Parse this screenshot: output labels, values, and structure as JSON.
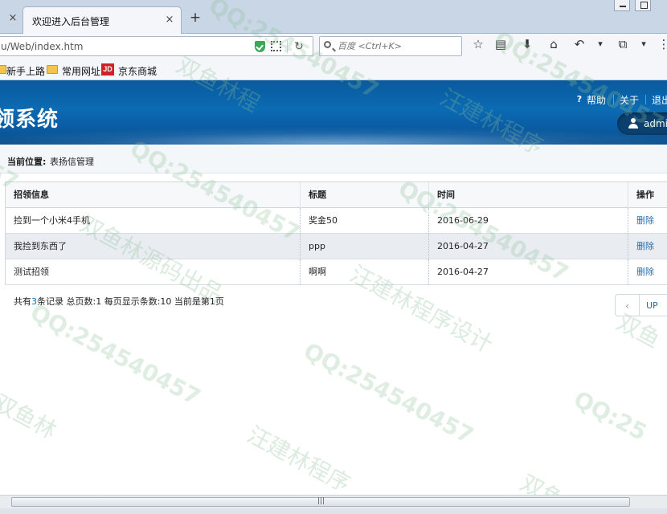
{
  "browser": {
    "tab_title": "欢迎进入后台管理",
    "tab_close_left": "×",
    "tab_close": "×",
    "new_tab": "+",
    "url": "u/Web/index.htm",
    "search_placeholder": "百度 <Ctrl+K>",
    "reload": "↻",
    "toolbar": {
      "star": "☆",
      "reader": "▤",
      "download": "⬇",
      "home": "⌂",
      "back": "↶",
      "dropdown": "▾",
      "crop": "⧉",
      "menu": "⋮"
    },
    "bookmarks": [
      {
        "label": "新手上路"
      },
      {
        "label": "常用网址"
      },
      {
        "label": "京东商城",
        "icon": "JD"
      }
    ]
  },
  "header": {
    "title": "领系统",
    "help": "帮助",
    "about": "关于",
    "logout": "退出",
    "user": "admin",
    "help_icon": "?"
  },
  "location": {
    "label": "当前位置:",
    "value": "表扬信管理"
  },
  "table": {
    "columns": [
      "招领信息",
      "标题",
      "时间",
      "操作"
    ],
    "rows": [
      {
        "info": "捡到一个小米4手机",
        "title": "奖金50",
        "time": "2016-06-29",
        "action": "删除"
      },
      {
        "info": "我捡到东西了",
        "title": "ppp",
        "time": "2016-04-27",
        "action": "删除"
      },
      {
        "info": "测试招领",
        "title": "啊啊",
        "time": "2016-04-27",
        "action": "删除"
      }
    ]
  },
  "summary": {
    "p1": "共有",
    "total": "3",
    "p2": "条记录 总页数:",
    "pages": "1",
    "p3": " 每页显示条数:",
    "per_page": "10",
    "p4": " 当前是第",
    "current": "1",
    "p5": "页"
  },
  "pager": {
    "prev": "‹",
    "up": "UP"
  },
  "watermarks": {
    "qq": "QQ:254540457",
    "qq_short": "QQ:25",
    "studio_a": "汪建林程序设计",
    "studio_b": "双鱼林源码出品",
    "frag_1": "双鱼林程",
    "frag_2": "双鱼",
    "frag_3": "汪建林程序",
    "frag_4": "双鱼林",
    "frag_5": "57"
  },
  "scroll": {
    "grip": "|||"
  },
  "colors": {
    "header_blue": "#0b6bb3",
    "link_blue": "#1f6fb5",
    "tab_bar": "#c9d6e6"
  }
}
